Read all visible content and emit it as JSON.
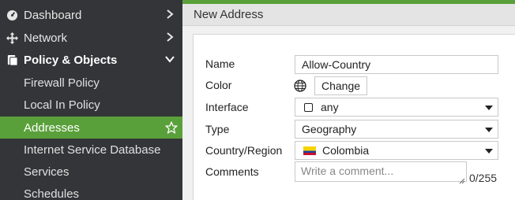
{
  "sidebar": {
    "items": [
      {
        "label": "Dashboard",
        "icon": "dashboard-icon"
      },
      {
        "label": "Network",
        "icon": "network-icon"
      },
      {
        "label": "Policy & Objects",
        "icon": "policy-icon",
        "expanded": true
      }
    ],
    "subitems": [
      {
        "label": "Firewall Policy"
      },
      {
        "label": "Local In Policy"
      },
      {
        "label": "Addresses",
        "active": true
      },
      {
        "label": "Internet Service Database"
      },
      {
        "label": "Services"
      },
      {
        "label": "Schedules"
      }
    ]
  },
  "header": {
    "title": "New Address"
  },
  "form": {
    "name": {
      "label": "Name",
      "value": "Allow-Country"
    },
    "color": {
      "label": "Color",
      "button": "Change"
    },
    "interface": {
      "label": "Interface",
      "value": "any"
    },
    "type": {
      "label": "Type",
      "value": "Geography"
    },
    "country": {
      "label": "Country/Region",
      "value": "Colombia"
    },
    "comments": {
      "label": "Comments",
      "placeholder": "Write a comment...",
      "counter": "0/255"
    }
  },
  "colors": {
    "accent": "#5aa03a",
    "sidebar_bg": "#333538"
  }
}
